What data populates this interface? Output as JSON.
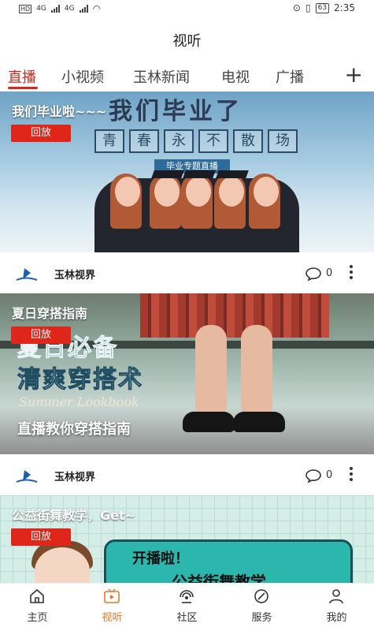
{
  "status_bar": {
    "net1": "4G",
    "net2": "4G",
    "battery": "63",
    "time": "2:35"
  },
  "header": {
    "title": "视听"
  },
  "tabs": [
    {
      "label": "直播",
      "active": true
    },
    {
      "label": "小视频"
    },
    {
      "label": "玉林新闻"
    },
    {
      "label": "电视"
    },
    {
      "label": "广播"
    }
  ],
  "tab_add": "+",
  "cards": [
    {
      "title": "我们毕业啦~~~",
      "replay": "回放",
      "art_title": "我们毕业了",
      "art_boxes": [
        "青",
        "春",
        "永",
        "不",
        "散",
        "场"
      ],
      "art_banner": "毕业专题直播",
      "source": "玉林视界",
      "comments": "0"
    },
    {
      "title": "夏日穿搭指南",
      "replay": "回放",
      "art_line1": "夏日必备",
      "art_line2": "清爽穿搭术",
      "art_line3": "Summer Lookbook",
      "art_line4": "直播教你穿搭指南",
      "source": "玉林视界",
      "comments": "0"
    },
    {
      "title": "公益街舞教学，Get~",
      "replay": "回放",
      "art_line1": "开播啦！",
      "art_line2": "公益街舞教学"
    }
  ],
  "bottom_nav": [
    {
      "label": "主页",
      "icon": "home-icon"
    },
    {
      "label": "视听",
      "icon": "video-icon",
      "active": true
    },
    {
      "label": "社区",
      "icon": "community-icon"
    },
    {
      "label": "服务",
      "icon": "service-icon"
    },
    {
      "label": "我的",
      "icon": "profile-icon"
    }
  ],
  "colors": {
    "accent": "#d8261b",
    "active_nav": "#e07a2a"
  }
}
